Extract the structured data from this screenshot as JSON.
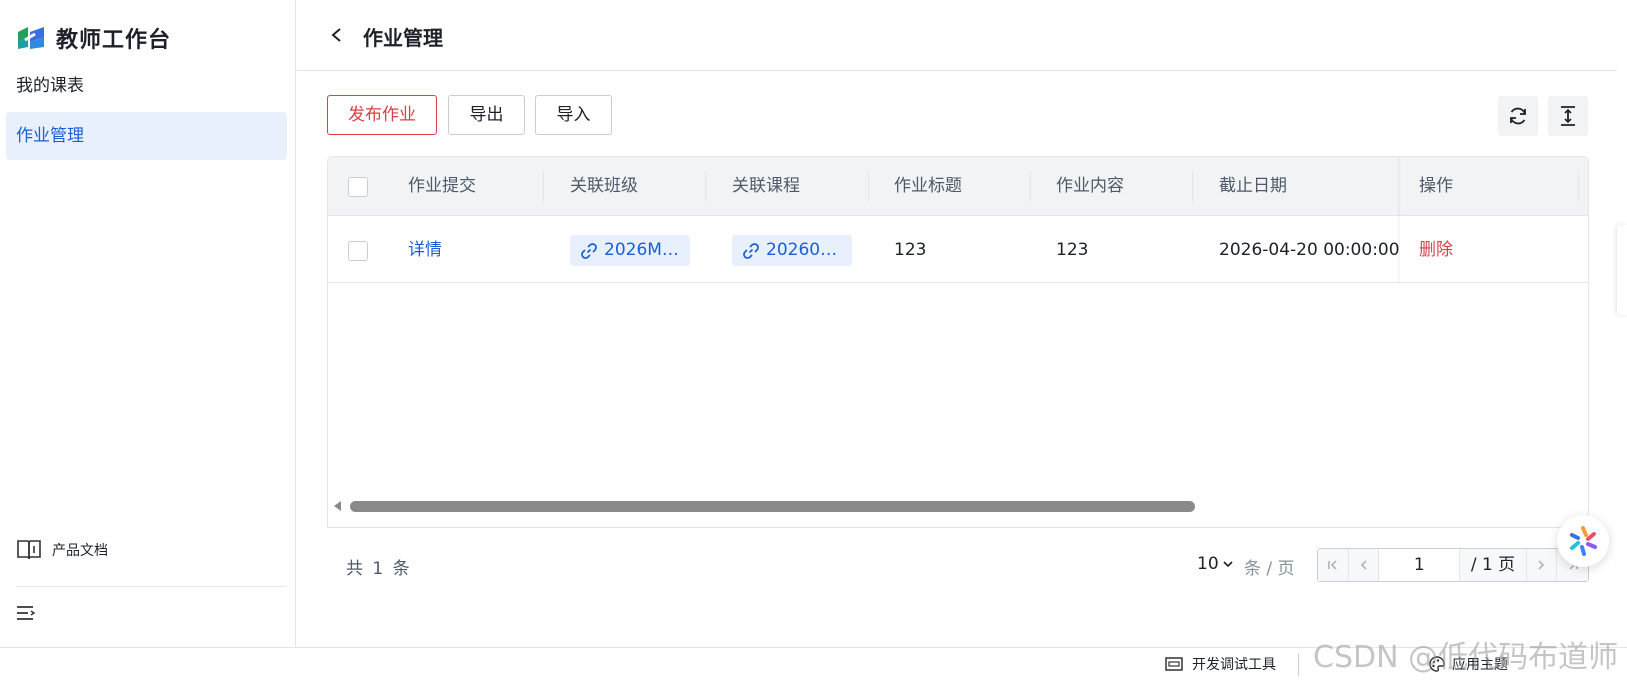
{
  "sidebar": {
    "brand_title": "教师工作台",
    "items": [
      {
        "label": "我的课表",
        "active": false
      },
      {
        "label": "作业管理",
        "active": true
      }
    ],
    "doc_label": "产品文档"
  },
  "header": {
    "title": "作业管理"
  },
  "toolbar": {
    "publish_label": "发布作业",
    "export_label": "导出",
    "import_label": "导入"
  },
  "table": {
    "columns": [
      "作业提交",
      "关联班级",
      "关联课程",
      "作业标题",
      "作业内容",
      "截止日期",
      "操作"
    ],
    "rows": [
      {
        "submit": "详情",
        "class": "2026M…",
        "course": "20260…",
        "title": "123",
        "content": "123",
        "deadline": "2026-04-20 00:00:00",
        "action": "删除"
      }
    ]
  },
  "pagination": {
    "total_text": "共 1 条",
    "page_size": "10",
    "size_unit": "条 / 页",
    "current_page": "1",
    "total_pages": "/ 1 页"
  },
  "footer": {
    "dev_tools_label": "开发调试工具",
    "theme_label": "应用主题"
  },
  "watermark": "CSDN @低代码布道师",
  "colors": {
    "accent": "#1a5fd6",
    "danger": "#d9404a",
    "active_bg": "#e8f0fd"
  }
}
